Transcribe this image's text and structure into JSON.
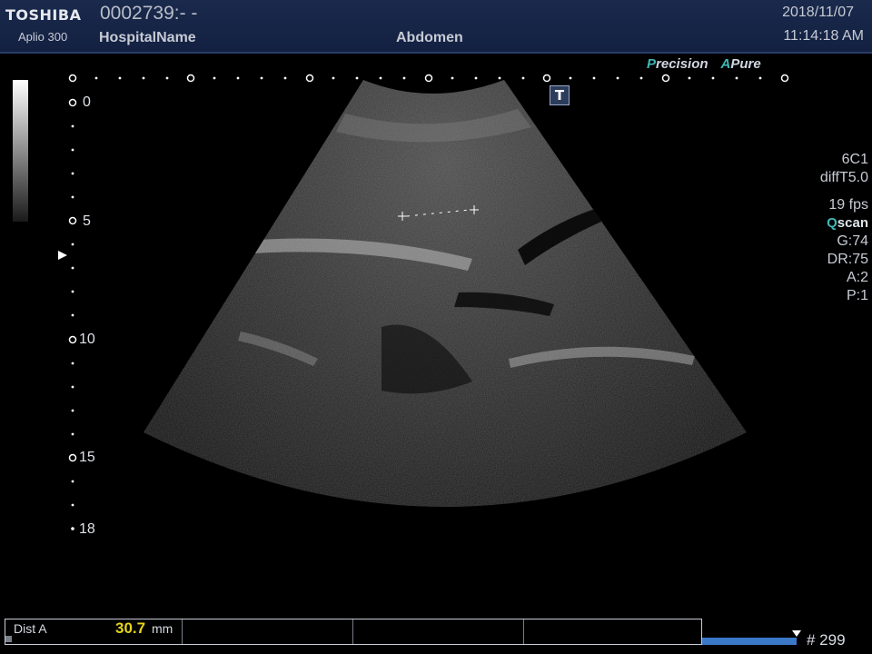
{
  "header": {
    "brand": "TOSHIBA",
    "model": "Aplio 300",
    "patient_id": "0002739:- -",
    "hospital": "HospitalName",
    "exam": "Abdomen",
    "date": "2018/11/07",
    "time": "11:14:18 AM"
  },
  "brand_tags": {
    "precision_initial": "P",
    "precision_rest": "recision",
    "apure_initial": "A",
    "apure_rest": "Pure"
  },
  "depth_scale": {
    "labels": [
      "0",
      "5",
      "10",
      "15",
      "18"
    ],
    "unit": "cm"
  },
  "t_button": "T",
  "params": {
    "probe": "6C1",
    "mode": "diffT5.0",
    "fps": "19 fps",
    "qscan_q": "Q",
    "qscan_rest": "scan",
    "gain": "G:74",
    "dynamic_range": "DR:75",
    "a": "A:2",
    "p": "P:1"
  },
  "measurement": {
    "name": "Dist A",
    "value": "30.7",
    "unit": "mm"
  },
  "cine": {
    "frame": "# 299",
    "progress": 0.99
  },
  "colors": {
    "header_bg": "#132041",
    "accent_teal": "#3fb8b8",
    "measure_yellow": "#e6d41a",
    "cine_blue": "#3b78c8"
  }
}
